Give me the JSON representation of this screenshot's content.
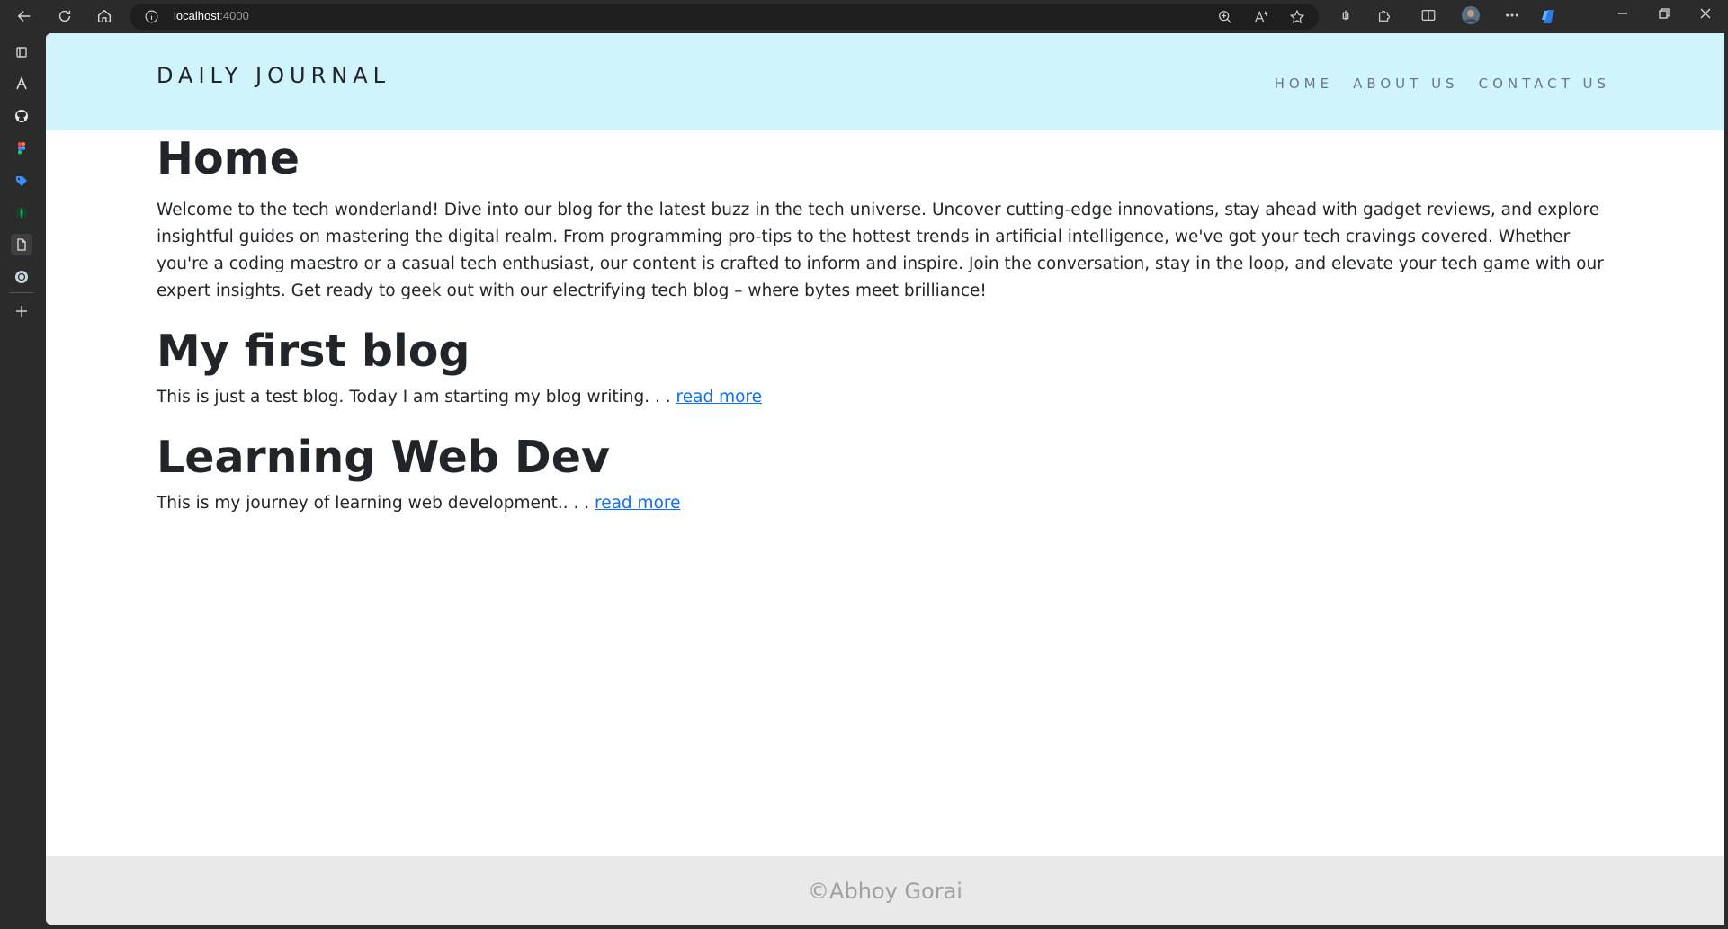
{
  "browser": {
    "url_host": "localhost",
    "url_port": ":4000"
  },
  "site": {
    "brand": "DAILY JOURNAL",
    "nav": [
      "HOME",
      "ABOUT US",
      "CONTACT US"
    ]
  },
  "page": {
    "title": "Home",
    "intro": "Welcome to the tech wonderland! Dive into our blog for the latest buzz in the tech universe. Uncover cutting-edge innovations, stay ahead with gadget reviews, and explore insightful guides on mastering the digital realm. From programming pro-tips to the hottest trends in artificial intelligence, we've got your tech cravings covered. Whether you're a coding maestro or a casual tech enthusiast, our content is crafted to inform and inspire. Join the conversation, stay in the loop, and elevate your tech game with our expert insights. Get ready to geek out with our electrifying tech blog – where bytes meet brilliance!",
    "posts": [
      {
        "title": "My first blog",
        "excerpt": "This is just a test blog. Today I am starting my blog writing. . . ",
        "link_label": "read more"
      },
      {
        "title": "Learning Web Dev",
        "excerpt": "This is my journey of learning web development.. . . ",
        "link_label": "read more"
      }
    ]
  },
  "footer": {
    "text": "©Abhoy Gorai"
  },
  "colors": {
    "header_bg": "#cff4fc",
    "link": "#0d6efd",
    "footer_bg": "#e9e9e9"
  }
}
